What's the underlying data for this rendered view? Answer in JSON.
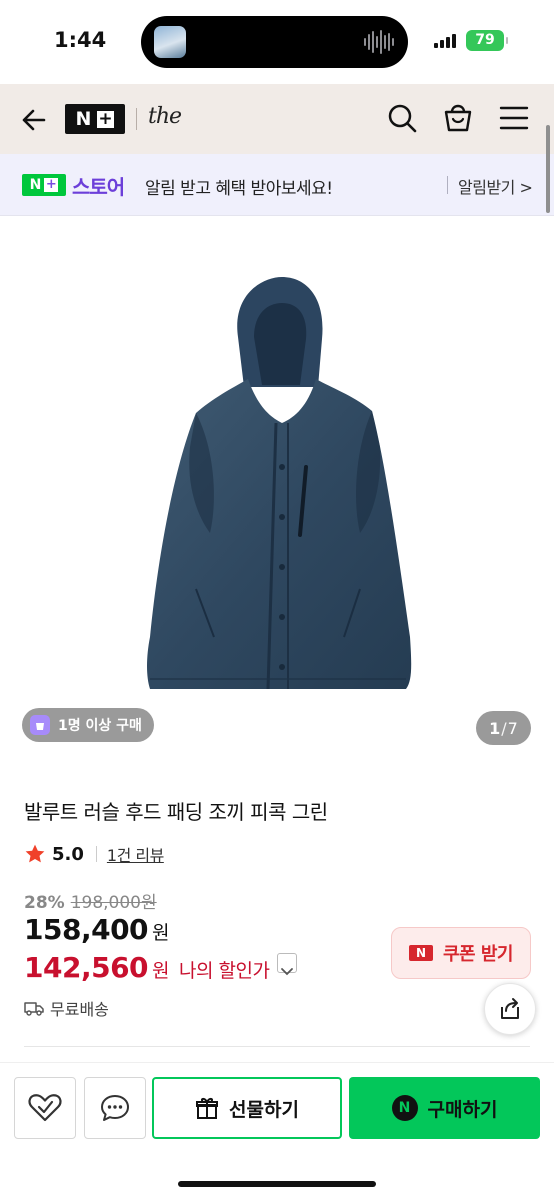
{
  "status_bar": {
    "time": "1:44",
    "battery": "79"
  },
  "header": {
    "nplus_logo_letter": "N",
    "nplus_logo_plus": "+",
    "brand_logo": "the"
  },
  "banner": {
    "store_logo_letter": "N",
    "store_logo_plus": "+",
    "store_name": "스토어",
    "message": "알림 받고 혜택 받아보세요!",
    "alarm_button": "알림받기 >"
  },
  "gallery": {
    "buyer_badge": "1명 이상 구매",
    "current": "1",
    "separator": "/",
    "total": "7"
  },
  "product": {
    "title": "발루트 러슬 후드 패딩 조끼 피콕 그린",
    "rating": "5.0",
    "reviews": "1건 리뷰",
    "discount_rate": "28%",
    "original_price": "198,000원",
    "price": "158,400",
    "price_unit": "원",
    "my_price": "142,560",
    "my_price_unit": "원",
    "my_price_label": "나의 할인가",
    "coupon_icon": "N",
    "coupon_button": "쿠폰 받기",
    "shipping": "무료배송"
  },
  "bottom_bar": {
    "gift_button": "선물하기",
    "buy_icon": "N",
    "buy_button": "구매하기"
  },
  "colors": {
    "naver_green": "#03c75a",
    "store_purple": "#6c3fd9",
    "price_red": "#c8102e",
    "coupon_red": "#d6272e",
    "header_bg": "#f1ebe7",
    "banner_bg": "#f0f0fc"
  }
}
